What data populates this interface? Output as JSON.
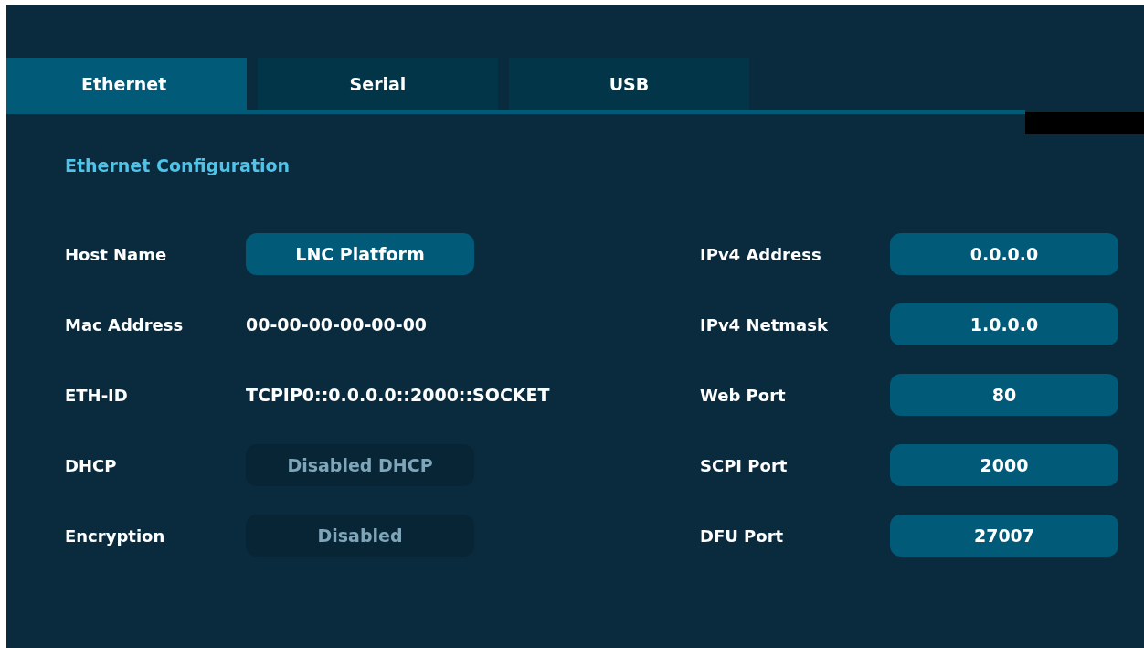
{
  "tabs": [
    {
      "label": "Ethernet",
      "selected": true
    },
    {
      "label": "Serial",
      "selected": false
    },
    {
      "label": "USB",
      "selected": false
    }
  ],
  "section_title": "Ethernet Configuration",
  "left_rows": [
    {
      "label": "Host Name",
      "kind": "field",
      "value": "LNC Platform",
      "disabled": false
    },
    {
      "label": "Mac Address",
      "kind": "text",
      "value": "00-00-00-00-00-00"
    },
    {
      "label": "ETH-ID",
      "kind": "text",
      "value": "TCPIP0::0.0.0.0::2000::SOCKET"
    },
    {
      "label": "DHCP",
      "kind": "field",
      "value": "Disabled DHCP",
      "disabled": true
    },
    {
      "label": "Encryption",
      "kind": "field",
      "value": "Disabled",
      "disabled": true
    }
  ],
  "right_rows": [
    {
      "label": "IPv4 Address",
      "kind": "field",
      "value": "0.0.0.0",
      "disabled": false
    },
    {
      "label": "IPv4 Netmask",
      "kind": "field",
      "value": "1.0.0.0",
      "disabled": false
    },
    {
      "label": "Web Port",
      "kind": "field",
      "value": "80",
      "disabled": false
    },
    {
      "label": "SCPI Port",
      "kind": "field",
      "value": "2000",
      "disabled": false
    },
    {
      "label": "DFU Port",
      "kind": "field",
      "value": "27007",
      "disabled": false
    }
  ]
}
